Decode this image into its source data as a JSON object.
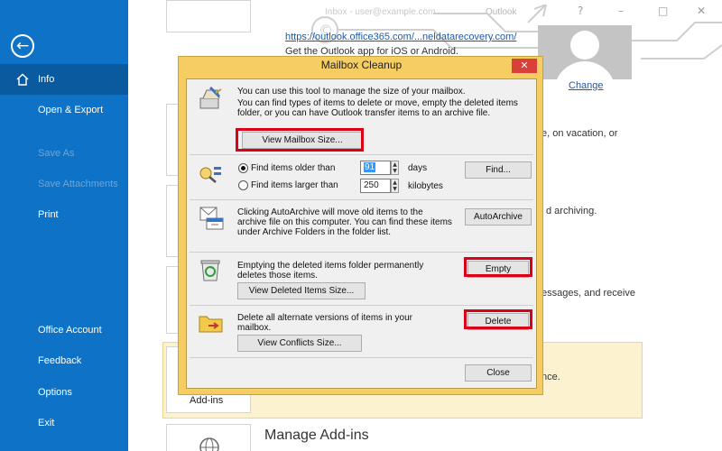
{
  "nav": {
    "items": [
      {
        "label": "Info",
        "state": "active"
      },
      {
        "label": "Open & Export",
        "state": "normal"
      },
      {
        "label": "Save As",
        "state": "disabled"
      },
      {
        "label": "Save Attachments",
        "state": "disabled"
      },
      {
        "label": "Print",
        "state": "normal"
      },
      {
        "label": "Office Account",
        "state": "normal"
      },
      {
        "label": "Feedback",
        "state": "normal"
      },
      {
        "label": "Options",
        "state": "normal"
      },
      {
        "label": "Exit",
        "state": "normal"
      }
    ],
    "back_icon": "arrow-left-icon",
    "info_icon": "home-icon"
  },
  "titlebar": {
    "blurred_text": "Inbox - user@example.com",
    "app_name": "Outlook",
    "controls": [
      "?",
      "–",
      "□",
      "✕"
    ]
  },
  "background": {
    "link": "https://outlook.office365.com/...neldatarecovery.com/",
    "app_text": "Get the Outlook app for iOS or Android.",
    "change_link": "Change",
    "frag_1": "e, on vacation, or",
    "frag_2": "d archiving.",
    "frag_3": "essages, and receive",
    "frag_4": "nce.",
    "addins_label": "Add-ins",
    "manage_title": "Manage Add-ins"
  },
  "dialog": {
    "title": "Mailbox Cleanup",
    "close": "✕",
    "intro": {
      "line1": "You can use this tool to manage the size of your mailbox.",
      "line2": "You can find types of items to delete or move, empty the deleted items folder, or you can have Outlook transfer items to an archive file.",
      "button": "View Mailbox Size..."
    },
    "find": {
      "option_older": "Find items older than",
      "older_value": "91",
      "older_unit": "days",
      "option_larger": "Find items larger than",
      "larger_value": "250",
      "larger_unit": "kilobytes",
      "button": "Find..."
    },
    "archive": {
      "text": "Clicking AutoArchive will move old items to the archive file on this computer. You can find these items under Archive Folders in the folder list.",
      "button": "AutoArchive"
    },
    "deleted": {
      "text": "Emptying the deleted items folder permanently deletes those items.",
      "button_empty": "Empty",
      "button_view": "View Deleted Items Size..."
    },
    "conflicts": {
      "text": "Delete all alternate versions of items in your mailbox.",
      "button_delete": "Delete",
      "button_view": "View Conflicts Size..."
    },
    "close_button": "Close"
  },
  "colors": {
    "nav_bg": "#0e72c6",
    "nav_active": "#0a5aa0",
    "dialog_frame": "#f5cd63",
    "highlight": "#d90018"
  }
}
